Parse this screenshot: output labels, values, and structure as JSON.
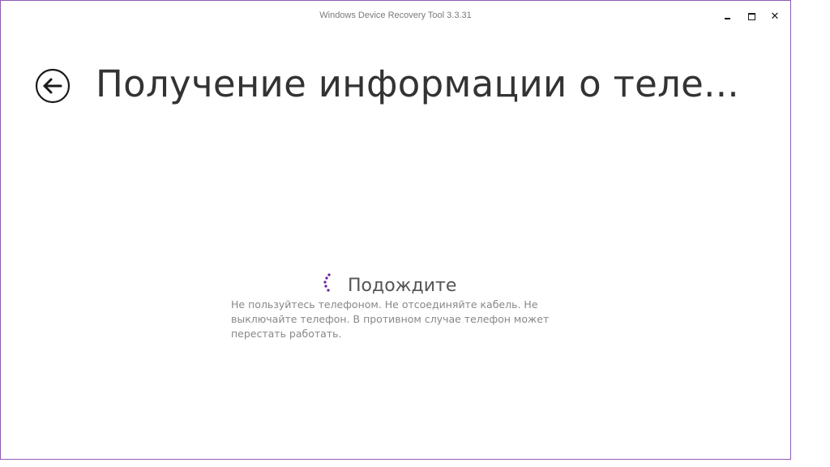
{
  "window": {
    "title": "Windows Device Recovery Tool 3.3.31",
    "border_color": "#8e5bb5",
    "controls": {
      "minimize_icon": "minimize-icon",
      "maximize_icon": "maximize-icon",
      "close_icon": "close-icon",
      "close_glyph": "✕"
    }
  },
  "header": {
    "back_icon": "back-arrow-icon",
    "title": "Получение информации о теле..."
  },
  "status": {
    "spinner_icon": "loading-spinner-icon",
    "accent_color": "#6a1b9a",
    "title": "Подождите",
    "description": "Не пользуйтесь телефоном. Не отсоединяйте кабель. Не выключайте телефон. В противном случае телефон может перестать работать."
  }
}
